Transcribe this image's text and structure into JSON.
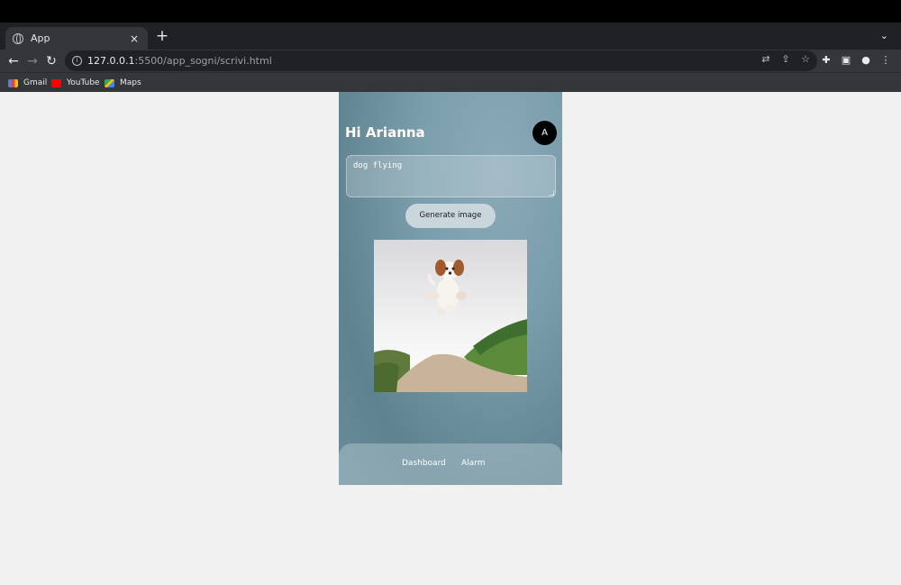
{
  "browser": {
    "tab_title": "App",
    "tab_close": "×",
    "new_tab": "+",
    "tabs_menu": "⌄",
    "url_host": "127.0.0.1",
    "url_rest": ":5500/app_sogni/scrivi.html",
    "bookmarks": [
      {
        "label": "Gmail",
        "icon": "gmail-icon"
      },
      {
        "label": "YouTube",
        "icon": "youtube-icon"
      },
      {
        "label": "Maps",
        "icon": "maps-icon"
      }
    ]
  },
  "app": {
    "greeting": "Hi Arianna",
    "avatar_initial": "A",
    "prompt_value": "dog flying",
    "generate_label": "Generate image",
    "image_icon": "dog-flying-image",
    "nav": {
      "dashboard": "Dashboard",
      "alarm": "Alarm"
    }
  },
  "colors": {
    "panel_top": "#8aa9b7",
    "panel_bottom": "#5f8290",
    "button_bg": "#c9d6dc",
    "avatar_bg": "#000000"
  }
}
